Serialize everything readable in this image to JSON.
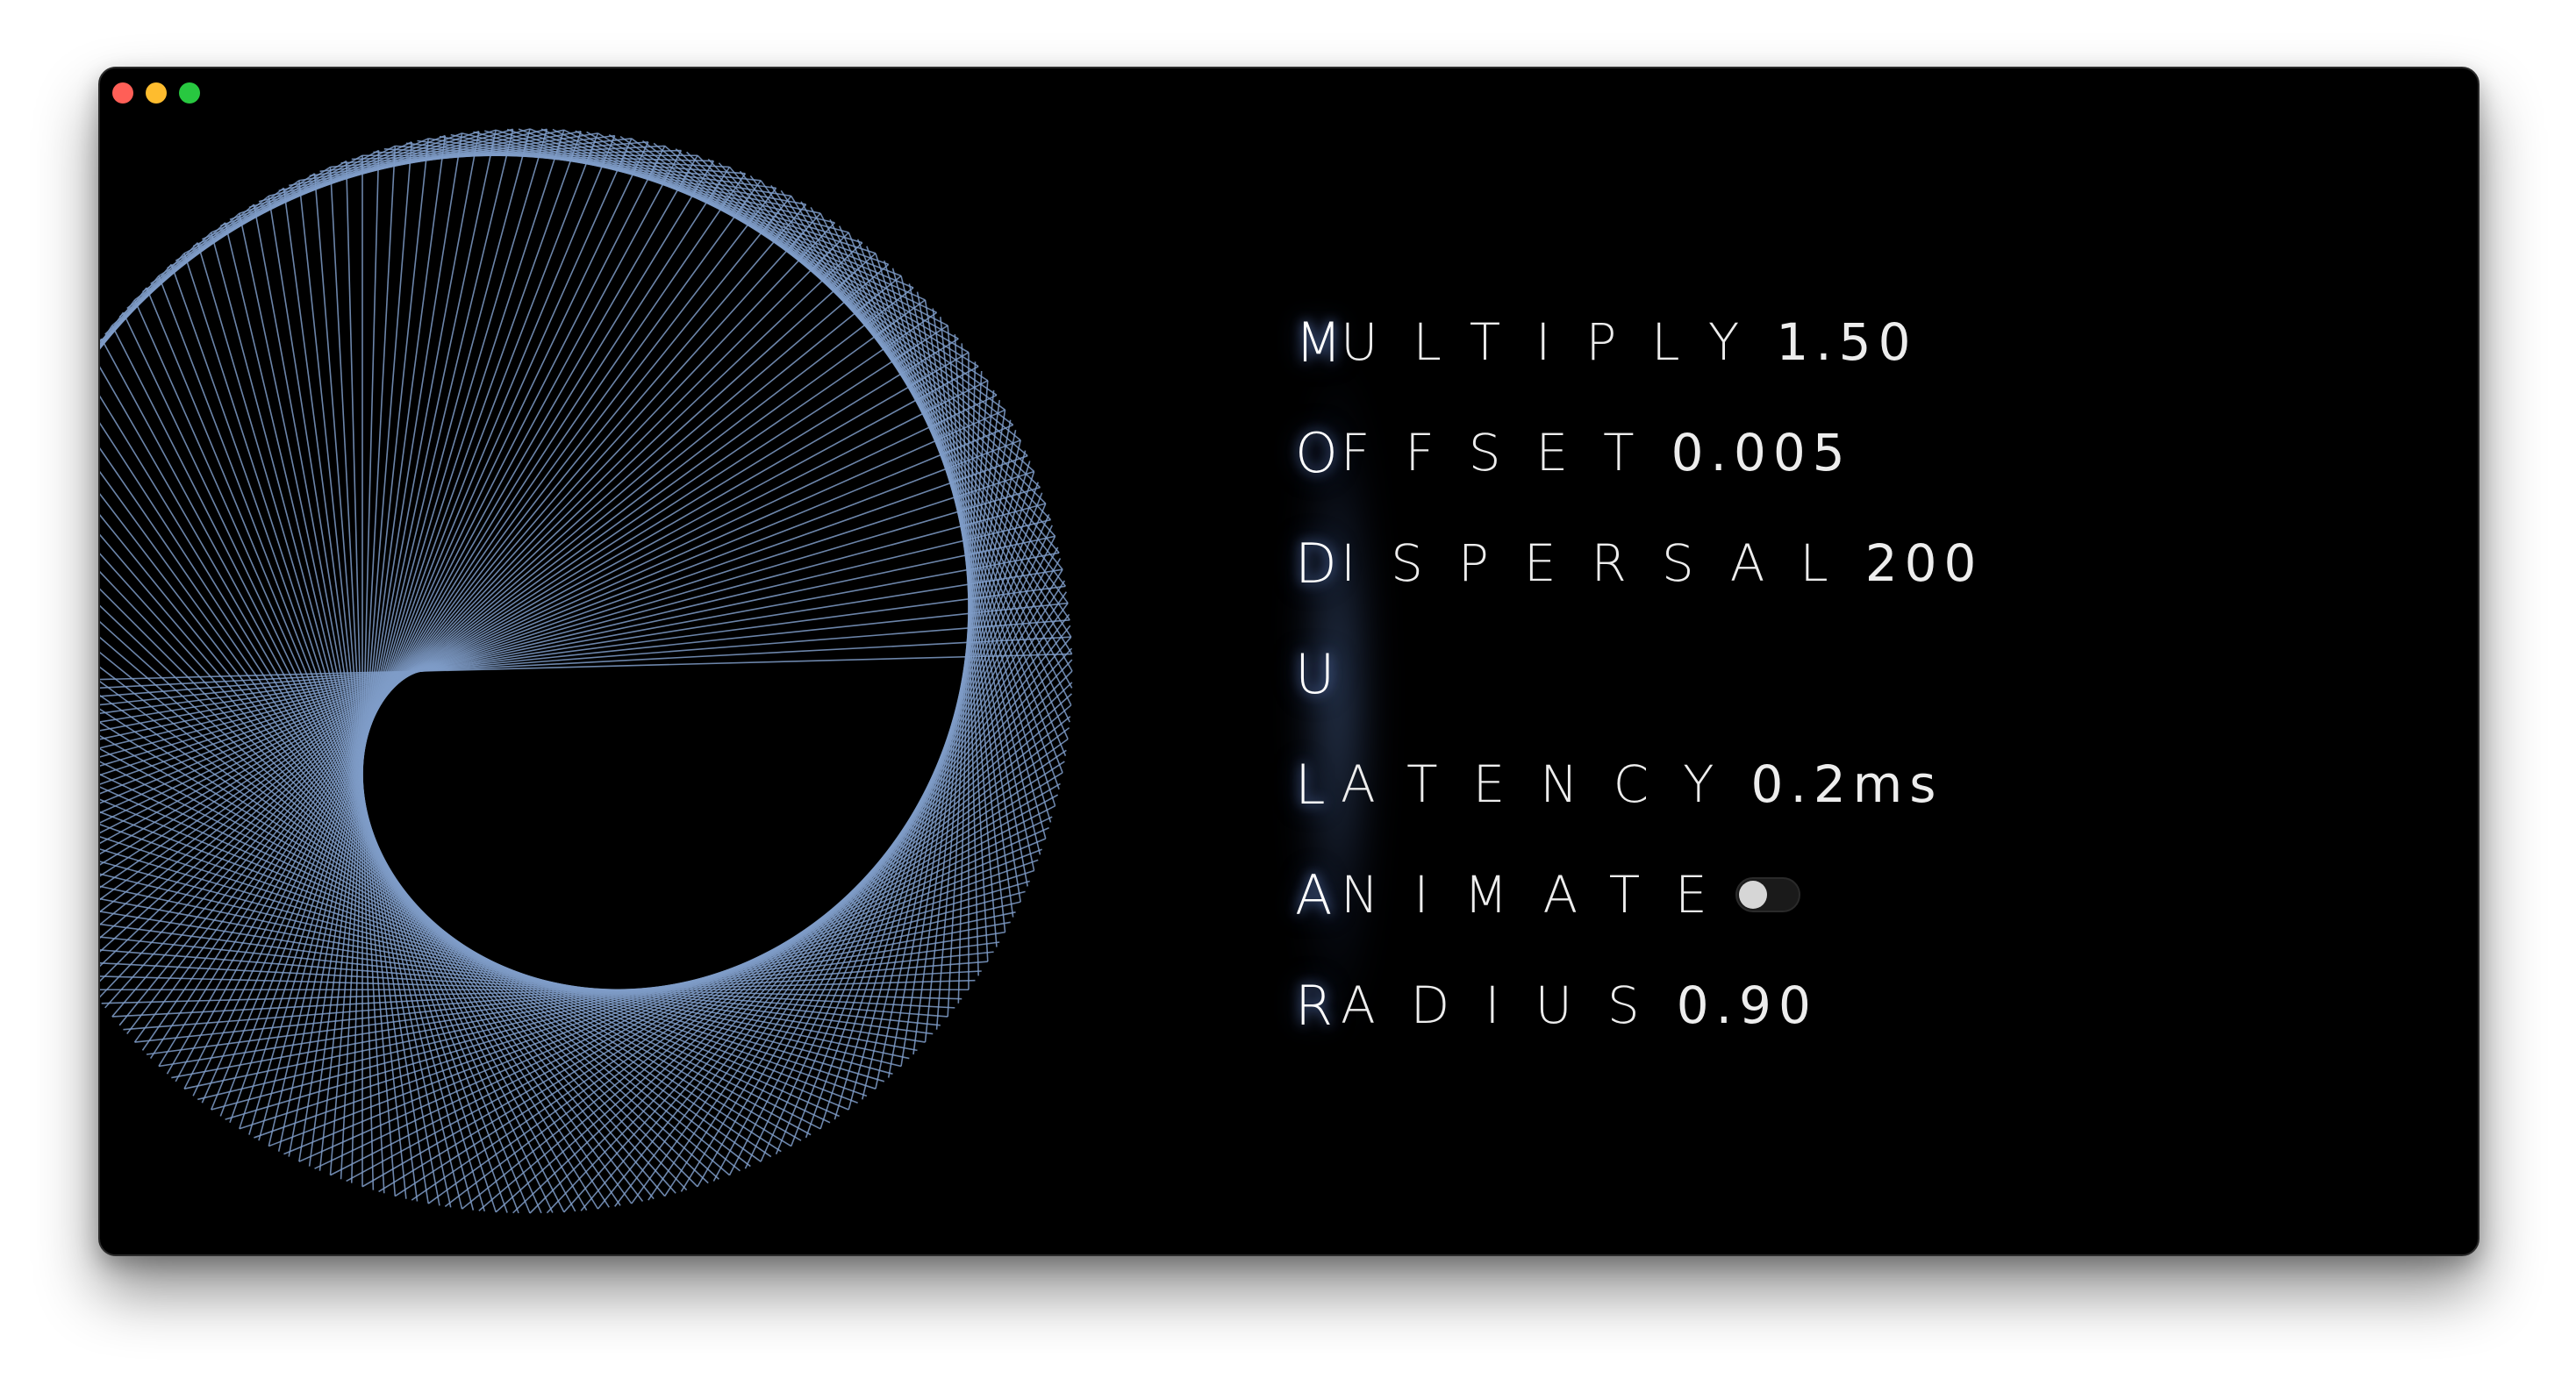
{
  "window": {
    "traffic_lights": [
      {
        "name": "close",
        "color": "#ff5f57"
      },
      {
        "name": "minimize",
        "color": "#febc2e"
      },
      {
        "name": "zoom",
        "color": "#28c840"
      }
    ]
  },
  "colors": {
    "background": "#000000",
    "line": "#7f9cc8",
    "text": "#ededed",
    "glow": "#6e96dc"
  },
  "controls": [
    {
      "initial": "M",
      "rest": "ULTIPLY",
      "value": "1.50"
    },
    {
      "initial": "O",
      "rest": "FFSET",
      "value": "0.005"
    },
    {
      "initial": "D",
      "rest": "ISPERSAL",
      "value": "200"
    },
    {
      "initial": "U",
      "rest": "",
      "value": ""
    },
    {
      "initial": "L",
      "rest": "ATENCY",
      "value": "0.2ms"
    },
    {
      "initial": "A",
      "rest": "NIMATE",
      "value": "",
      "toggle": false
    },
    {
      "initial": "R",
      "rest": "ADIUS",
      "value": "0.90"
    }
  ],
  "visual": {
    "type": "string-art-circle",
    "multiply": 1.5,
    "radius": 0.9
  }
}
